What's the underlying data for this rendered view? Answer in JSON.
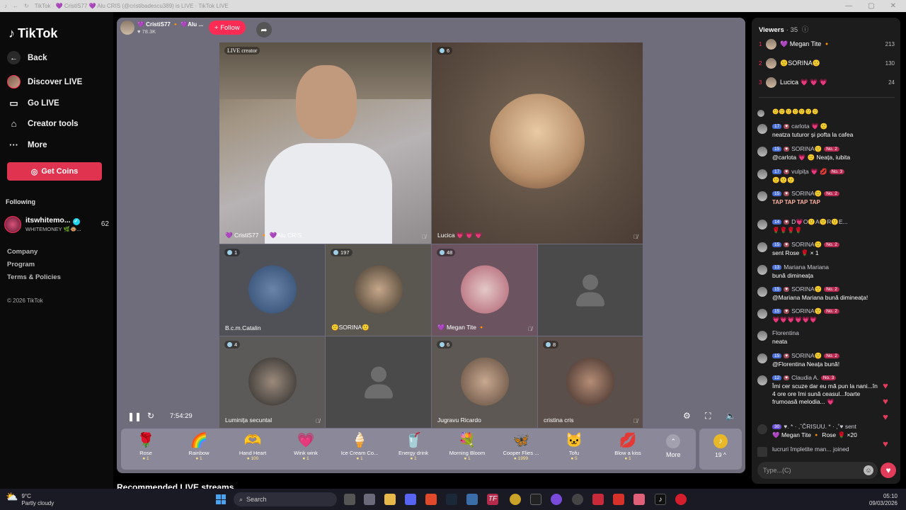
{
  "browser": {
    "tab_title": "TikTok · 💜 CristiS77 💜 Alu CRIS (@cristibadescu389) is LIVE · TikTok LIVE"
  },
  "sidebar": {
    "logo": "TikTok",
    "back": "Back",
    "items": [
      {
        "label": "Discover LIVE",
        "icon": "avatar"
      },
      {
        "label": "Go LIVE",
        "icon": "video-camera-icon"
      },
      {
        "label": "Creator tools",
        "icon": "home-icon"
      },
      {
        "label": "More",
        "icon": "ellipsis-icon"
      }
    ],
    "coins_button": "Get Coins",
    "following_label": "Following",
    "following": [
      {
        "name": "itswhitemo...",
        "sub": "WHITEMONEY 🌿🐵...",
        "count": "62"
      }
    ],
    "footer": [
      "Company",
      "Program",
      "Terms & Policies"
    ],
    "copyright": "© 2026 TikTok"
  },
  "stream": {
    "host_name": "💜 CristiS77 🔸 💜Alu ...",
    "host_likes": "78.3K",
    "follow_label": "+ Follow",
    "tiles": [
      {
        "name": "💜 CristiS77 🔸 💜Alu CRIS",
        "badge": "LIVE creator"
      },
      {
        "name": "Lucica 💗 💗 💗",
        "badge": "6"
      },
      {
        "name": "B.c.m.Catalin",
        "badge": "1"
      },
      {
        "name": "🙂SORINA🙂",
        "badge": "197"
      },
      {
        "name": "💜 Megan Tite 🔸",
        "badge": "48"
      },
      {
        "name": "",
        "badge": ""
      },
      {
        "name": "Luminița secuntal",
        "badge": "4"
      },
      {
        "name": "",
        "badge": ""
      },
      {
        "name": "Jugravu Ricardo",
        "badge": "6"
      },
      {
        "name": "cristina cris",
        "badge": "8"
      }
    ],
    "timer": "7:54:29",
    "gifts": [
      {
        "name": "Rose",
        "price": "1",
        "icon": "🌹"
      },
      {
        "name": "Rainbow",
        "price": "1",
        "icon": "🌈"
      },
      {
        "name": "Hand Heart",
        "price": "100",
        "icon": "🫶"
      },
      {
        "name": "Wink wink",
        "price": "1",
        "icon": "💗"
      },
      {
        "name": "Ice Cream Co...",
        "price": "1",
        "icon": "🍦"
      },
      {
        "name": "Energy drink",
        "price": "1",
        "icon": "🥤"
      },
      {
        "name": "Morning Bloom",
        "price": "1",
        "icon": "💐"
      },
      {
        "name": "Cooper Flies ...",
        "price": "1999",
        "icon": "🦋"
      },
      {
        "name": "Tofu",
        "price": "5",
        "icon": "🐱"
      },
      {
        "name": "Blow a kiss",
        "price": "1",
        "icon": "💋"
      }
    ],
    "more_label": "More",
    "coin_value": "19 ^"
  },
  "recommended_title": "Recommended LIVE streams",
  "viewers": {
    "title": "Viewers",
    "count": "· 35",
    "list": [
      {
        "rank": "1",
        "name": "💜 Megan Tite 🔸",
        "score": "213"
      },
      {
        "rank": "2",
        "name": "🙂SORINA🙂",
        "score": "130"
      },
      {
        "rank": "3",
        "name": "Lucica 💗 💗 💗",
        "score": "24"
      }
    ]
  },
  "chat": [
    {
      "name": "🙂🙂🙂🙂🙂🙂🙂",
      "level": "",
      "rank": "",
      "text": ""
    },
    {
      "name": "carlota 💗 🙂",
      "level": "17",
      "rank": "",
      "text": "neatza tuturor și pofta la cafea"
    },
    {
      "name": "SORINA🙂",
      "level": "15",
      "rank": "No. 2",
      "text": "@carlota 💗 🙂 Neața, iubita"
    },
    {
      "name": "vulpița 💗 💋",
      "level": "17",
      "rank": "No. 3",
      "text": "🙂🙂🙂"
    },
    {
      "name": "SORINA🙂",
      "level": "15",
      "rank": "No. 2",
      "text": "TAP TAP TAP TAP"
    },
    {
      "name": "D💗O🙂A🙂R🙂E...",
      "level": "14",
      "rank": "",
      "text": "🌹🌹🌹🌹"
    },
    {
      "name": "SORINA🙂",
      "level": "15",
      "rank": "No. 2",
      "text": "sent Rose 🌹 × 1"
    },
    {
      "name": "Mariana Mariana",
      "level": "13",
      "rank": "",
      "text": "bună dimineața"
    },
    {
      "name": "SORINA🙂",
      "level": "15",
      "rank": "No. 2",
      "text": "@Mariana Mariana bună dimineața!"
    },
    {
      "name": "SORINA🙂",
      "level": "15",
      "rank": "No. 2",
      "text": "💗💗💗💗💗💗"
    },
    {
      "name": "Florentina",
      "level": "",
      "rank": "",
      "text": "neata"
    },
    {
      "name": "SORINA🙂",
      "level": "15",
      "rank": "No. 2",
      "text": "@Florentina Neața bună!"
    },
    {
      "name": "Claudia A.",
      "level": "12",
      "rank": "No. 3",
      "text": "Îmi cer scuze dar eu mă pun la nani...în 4 ore ore îmi sună ceasul...foarte frumoasă melodia... 💗"
    },
    {
      "name": "♥.  *  · ,ˇČRISUU. * · ,˚♥ sent",
      "level": "30",
      "rank": "",
      "text": "💜 Megan Tite 🔸  Rose 🌹 ×20"
    },
    {
      "name": "",
      "level": "",
      "rank": "",
      "text": "lucruri împletite man...   joined"
    }
  ],
  "chat_input_placeholder": "Type...(C)",
  "taskbar": {
    "temperature": "9°C",
    "weather": "Partly cloudy",
    "search": "Search",
    "time": "05:10",
    "date": "09/03/2026"
  }
}
